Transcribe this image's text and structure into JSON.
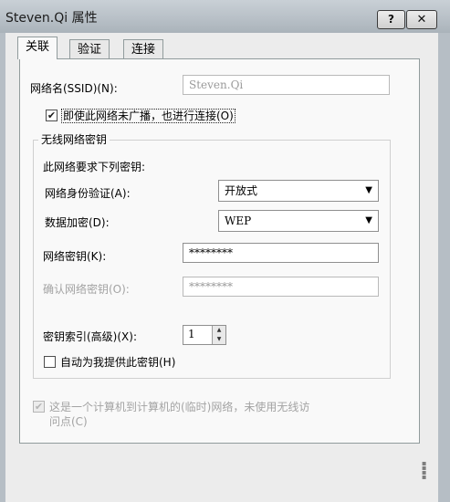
{
  "window": {
    "title": "Steven.Qi 属性",
    "help_label": "?",
    "close_label": "✕"
  },
  "tabs": [
    {
      "label": "关联",
      "active": true
    },
    {
      "label": "验证",
      "active": false
    },
    {
      "label": "连接",
      "active": false
    }
  ],
  "ssid": {
    "label": "网络名(SSID)(N):",
    "value": "Steven.Qi"
  },
  "broadcast_checkbox": {
    "label": "即使此网络未广播，也进行连接(O)",
    "checked": true
  },
  "wireless_key_group": {
    "title": "无线网络密钥",
    "requires_label": "此网络要求下列密钥:",
    "auth": {
      "label": "网络身份验证(A):",
      "value": "开放式"
    },
    "encryption": {
      "label": "数据加密(D):",
      "value": "WEP"
    },
    "network_key": {
      "label": "网络密钥(K):",
      "value": "********"
    },
    "confirm_key": {
      "label": "确认网络密钥(O):",
      "value": "********"
    },
    "key_index": {
      "label": "密钥索引(高级)(X):",
      "value": "1"
    },
    "auto_key": {
      "label": "自动为我提供此密钥(H)",
      "checked": false
    }
  },
  "adhoc_checkbox": {
    "line1": "这是一个计算机到计算机的(临时)网络，未使用无线访",
    "line2": "问点(C)",
    "checked": true,
    "enabled": false
  },
  "icons": {
    "dropdown": "chevron-down-icon",
    "spin_up": "spin-up-icon",
    "spin_down": "spin-down-icon",
    "check": "check-icon"
  }
}
